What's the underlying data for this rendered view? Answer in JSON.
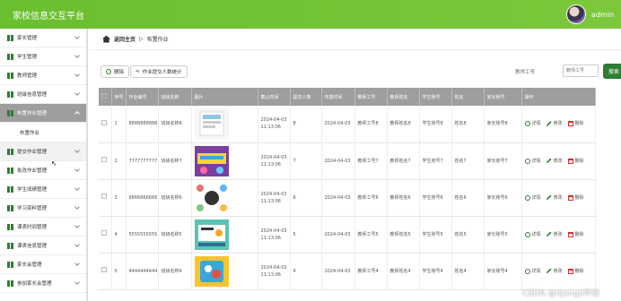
{
  "header": {
    "title": "家校信息交互平台",
    "username": "admin"
  },
  "sidebar": {
    "items": [
      {
        "label": "家长管理"
      },
      {
        "label": "学生管理"
      },
      {
        "label": "教师管理"
      },
      {
        "label": "班级信息管理"
      },
      {
        "label": "布置作业管理",
        "active": true
      },
      {
        "label": "布置作业",
        "sub": true
      },
      {
        "label": "提交作业管理"
      },
      {
        "label": "批改作业管理"
      },
      {
        "label": "学生成绩管理"
      },
      {
        "label": "学习资料管理"
      },
      {
        "label": "课表时间管理"
      },
      {
        "label": "课表信息管理"
      },
      {
        "label": "家长会管理"
      },
      {
        "label": "参加家长会管理"
      }
    ]
  },
  "breadcrumb": {
    "home": "返回主页",
    "arrow": "▷",
    "current": "布置作业"
  },
  "toolbar": {
    "delete": "删除",
    "stats": "作业提交人数统计"
  },
  "search": {
    "label": "教师工号",
    "placeholder": "教师工号",
    "button": "搜索"
  },
  "table": {
    "headers": [
      "",
      "序号",
      "作业编号",
      "班级名称",
      "图片",
      "截止时间",
      "提交人数",
      "布置时间",
      "教师工号",
      "教师姓名",
      "学生账号",
      "姓名",
      "家长账号",
      "操作"
    ],
    "rows": [
      {
        "idx": "1",
        "code": "8888888888",
        "class": "班级名称8",
        "deadline": "2024-04-03 11:13:06",
        "count": "8",
        "time": "2024-04-03",
        "tno": "教师工号8",
        "tname": "教师姓名8",
        "sno": "学生账号8",
        "name": "姓名8",
        "pno": "家长账号8",
        "img": "a"
      },
      {
        "idx": "2",
        "code": "7777777777",
        "class": "班级名称7",
        "deadline": "2024-04-03 11:13:06",
        "count": "7",
        "time": "2024-04-03",
        "tno": "教师工号7",
        "tname": "教师姓名7",
        "sno": "学生账号7",
        "name": "姓名7",
        "pno": "家长账号7",
        "img": "b"
      },
      {
        "idx": "3",
        "code": "6666666666",
        "class": "班级名称6",
        "deadline": "2024-04-03 11:13:06",
        "count": "6",
        "time": "2024-04-03",
        "tno": "教师工号6",
        "tname": "教师姓名6",
        "sno": "学生账号6",
        "name": "姓名6",
        "pno": "家长账号6",
        "img": "c"
      },
      {
        "idx": "4",
        "code": "5555555555",
        "class": "班级名称5",
        "deadline": "2024-04-03 11:13:06",
        "count": "5",
        "time": "2024-04-03",
        "tno": "教师工号5",
        "tname": "教师姓名5",
        "sno": "学生账号5",
        "name": "姓名5",
        "pno": "家长账号5",
        "img": "d"
      },
      {
        "idx": "5",
        "code": "4444444444",
        "class": "班级名称4",
        "deadline": "2024-04-03 11:13:06",
        "count": "4",
        "time": "2024-04-03",
        "tno": "教师工号4",
        "tname": "教师姓名4",
        "sno": "学生账号4",
        "name": "姓名4",
        "pno": "家长账号4",
        "img": "e"
      }
    ],
    "ops": {
      "detail": "详情",
      "edit": "修改",
      "delete": "删除"
    }
  },
  "watermark": "CSDN @django毕设",
  "colors": {
    "primary": "#2e7d32",
    "header": "#6abf2e",
    "tablehead": "#9e9e9e"
  }
}
